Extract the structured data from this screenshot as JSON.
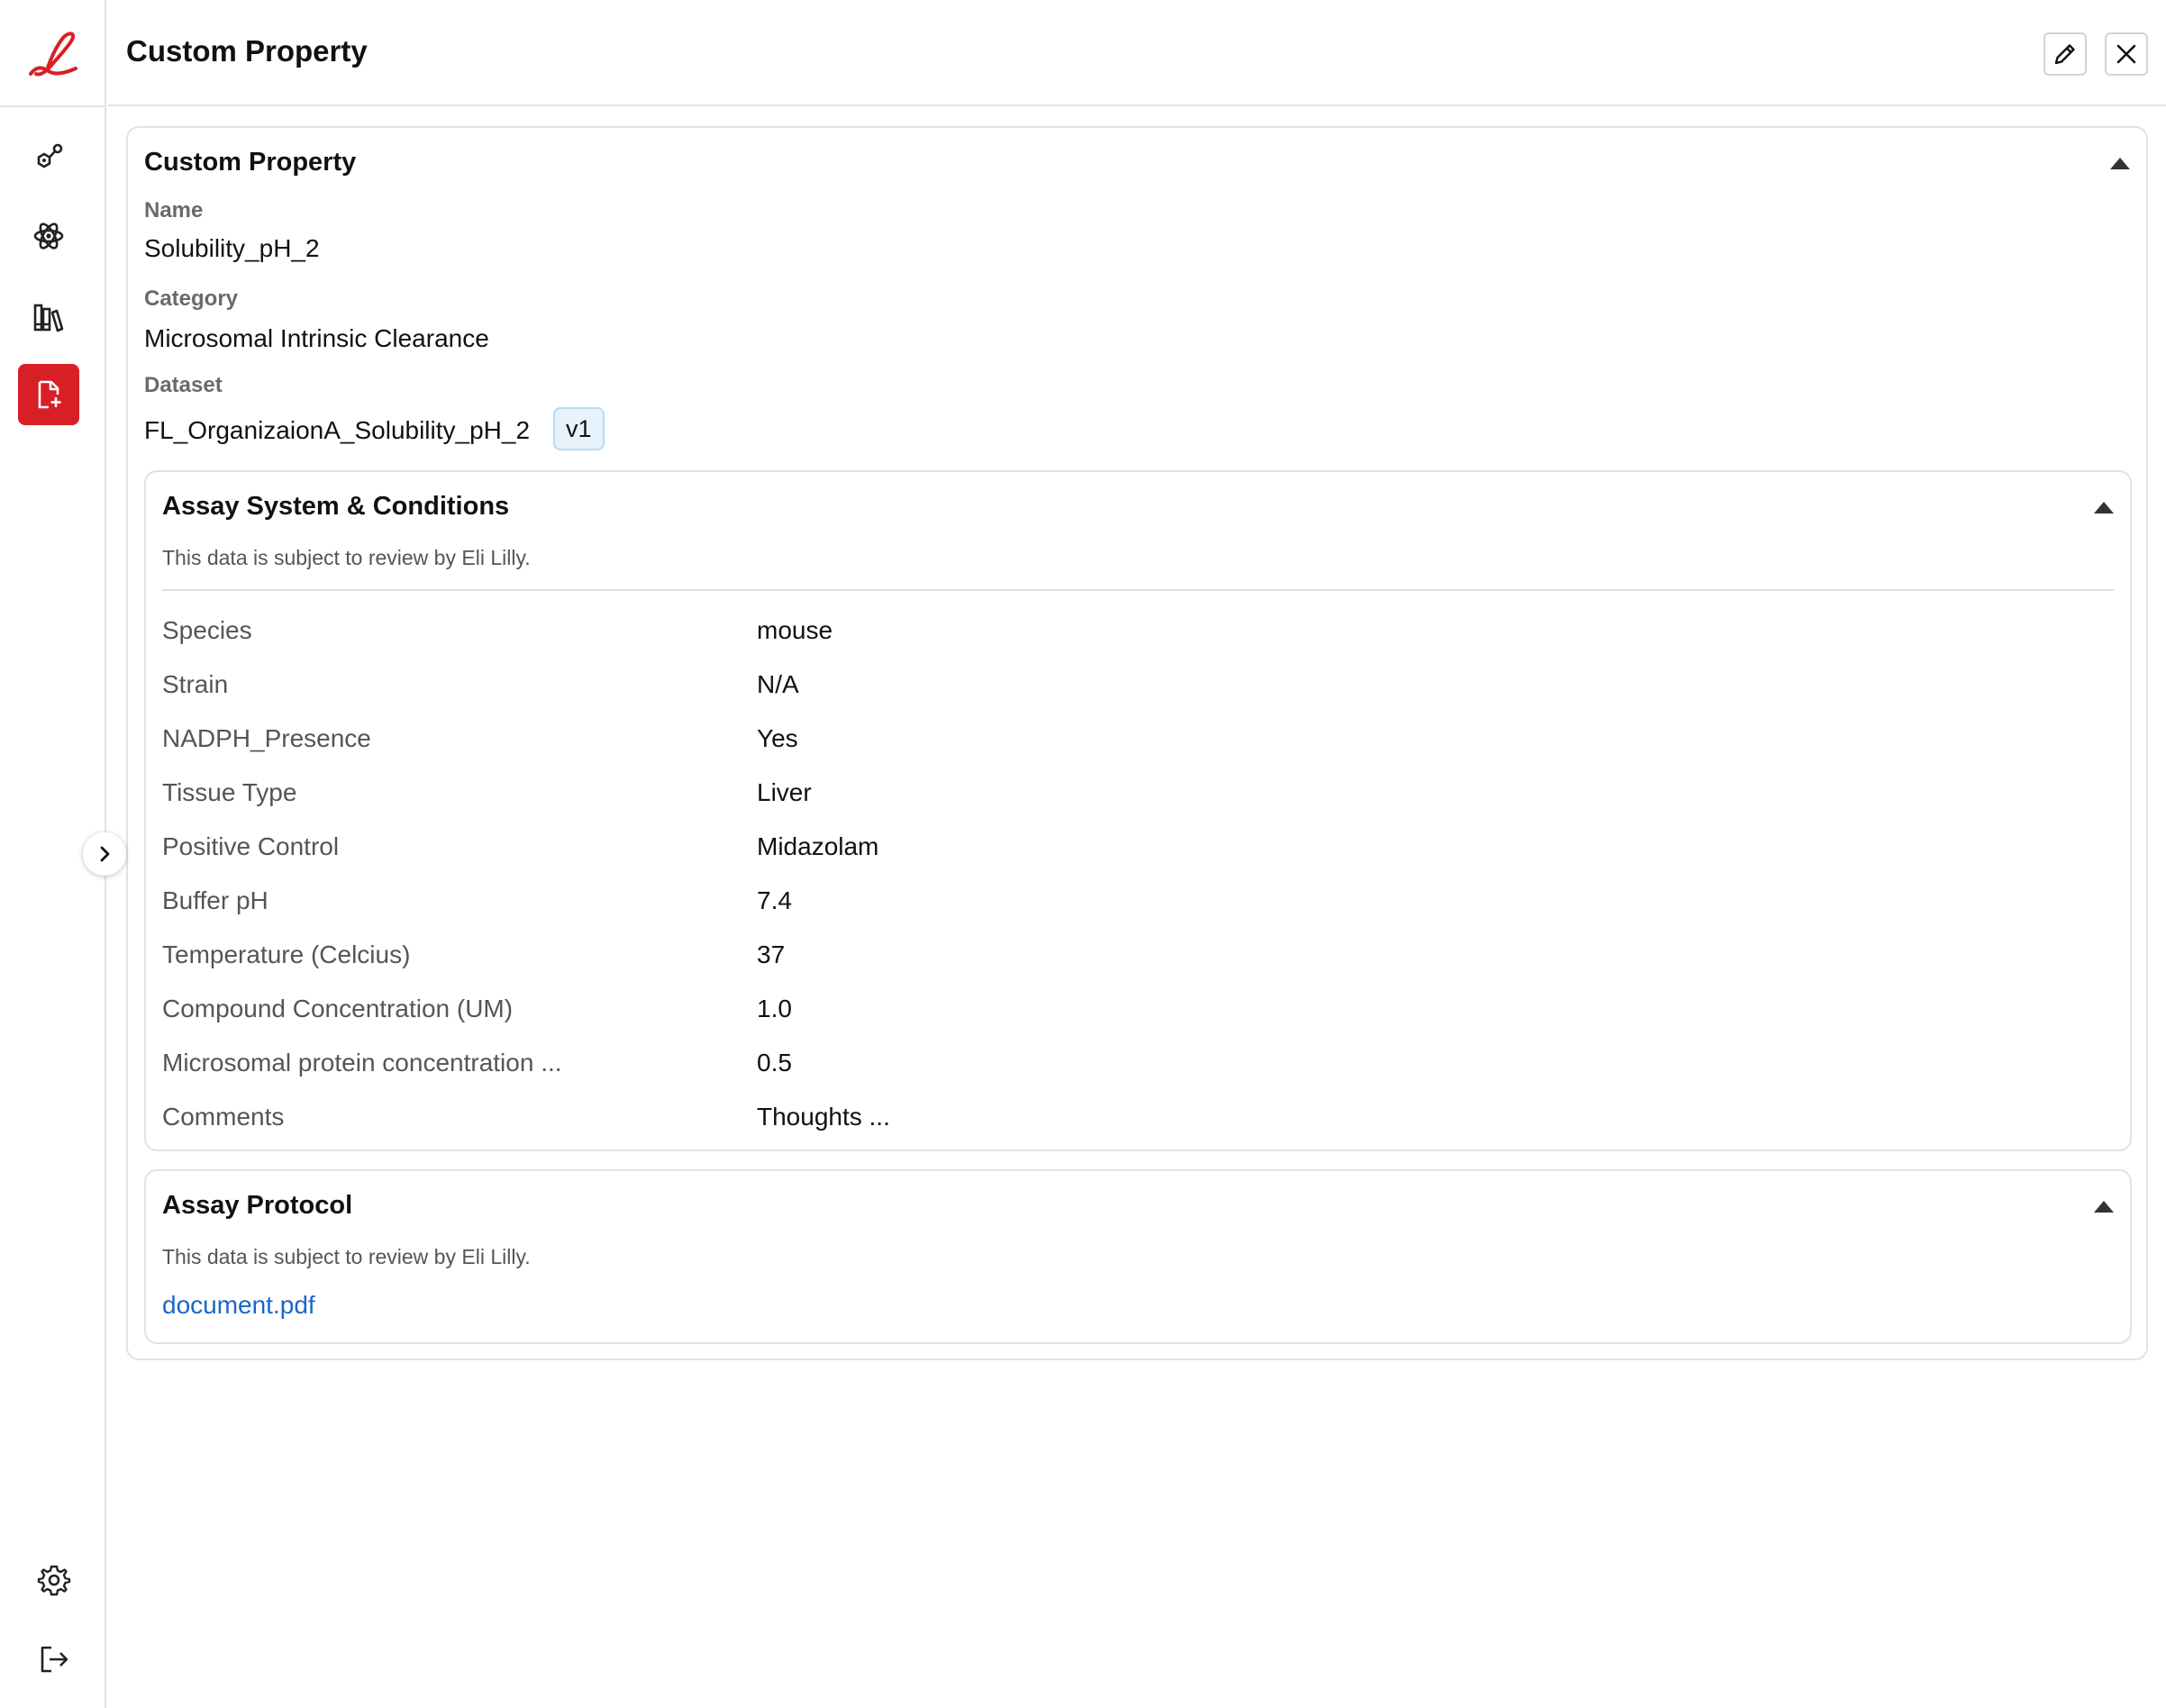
{
  "header": {
    "title": "Custom Property"
  },
  "sidebar": {
    "items": [
      {
        "name": "molecule-icon"
      },
      {
        "name": "atom-icon"
      },
      {
        "name": "library-icon"
      },
      {
        "name": "file-add-icon",
        "active": true
      }
    ],
    "bottom": [
      {
        "name": "gear-icon"
      },
      {
        "name": "logout-icon"
      }
    ],
    "accent": "#d81f26"
  },
  "card": {
    "title": "Custom Property",
    "name_label": "Name",
    "name_value": "Solubility_pH_2",
    "category_label": "Category",
    "category_value": "Microsomal Intrinsic Clearance",
    "dataset_label": "Dataset",
    "dataset_value": "FL_OrganizaionA_Solubility_pH_2",
    "dataset_version": "v1"
  },
  "assay_conditions": {
    "title": "Assay System & Conditions",
    "subtitle": "This data is subject to review by Eli Lilly.",
    "rows": [
      {
        "label": "Species",
        "value": "mouse"
      },
      {
        "label": "Strain",
        "value": "N/A"
      },
      {
        "label": "NADPH_Presence",
        "value": "Yes"
      },
      {
        "label": "Tissue Type",
        "value": "Liver"
      },
      {
        "label": "Positive Control",
        "value": "Midazolam"
      },
      {
        "label": "Buffer pH",
        "value": "7.4"
      },
      {
        "label": "Temperature (Celcius)",
        "value": "37"
      },
      {
        "label": "Compound Concentration (UM)",
        "value": "1.0"
      },
      {
        "label": "Microsomal protein concentration ...",
        "value": "0.5"
      },
      {
        "label": "Comments",
        "value": "Thoughts ..."
      }
    ]
  },
  "assay_protocol": {
    "title": "Assay Protocol",
    "subtitle": "This data is subject to review by Eli Lilly.",
    "document": "document.pdf"
  }
}
